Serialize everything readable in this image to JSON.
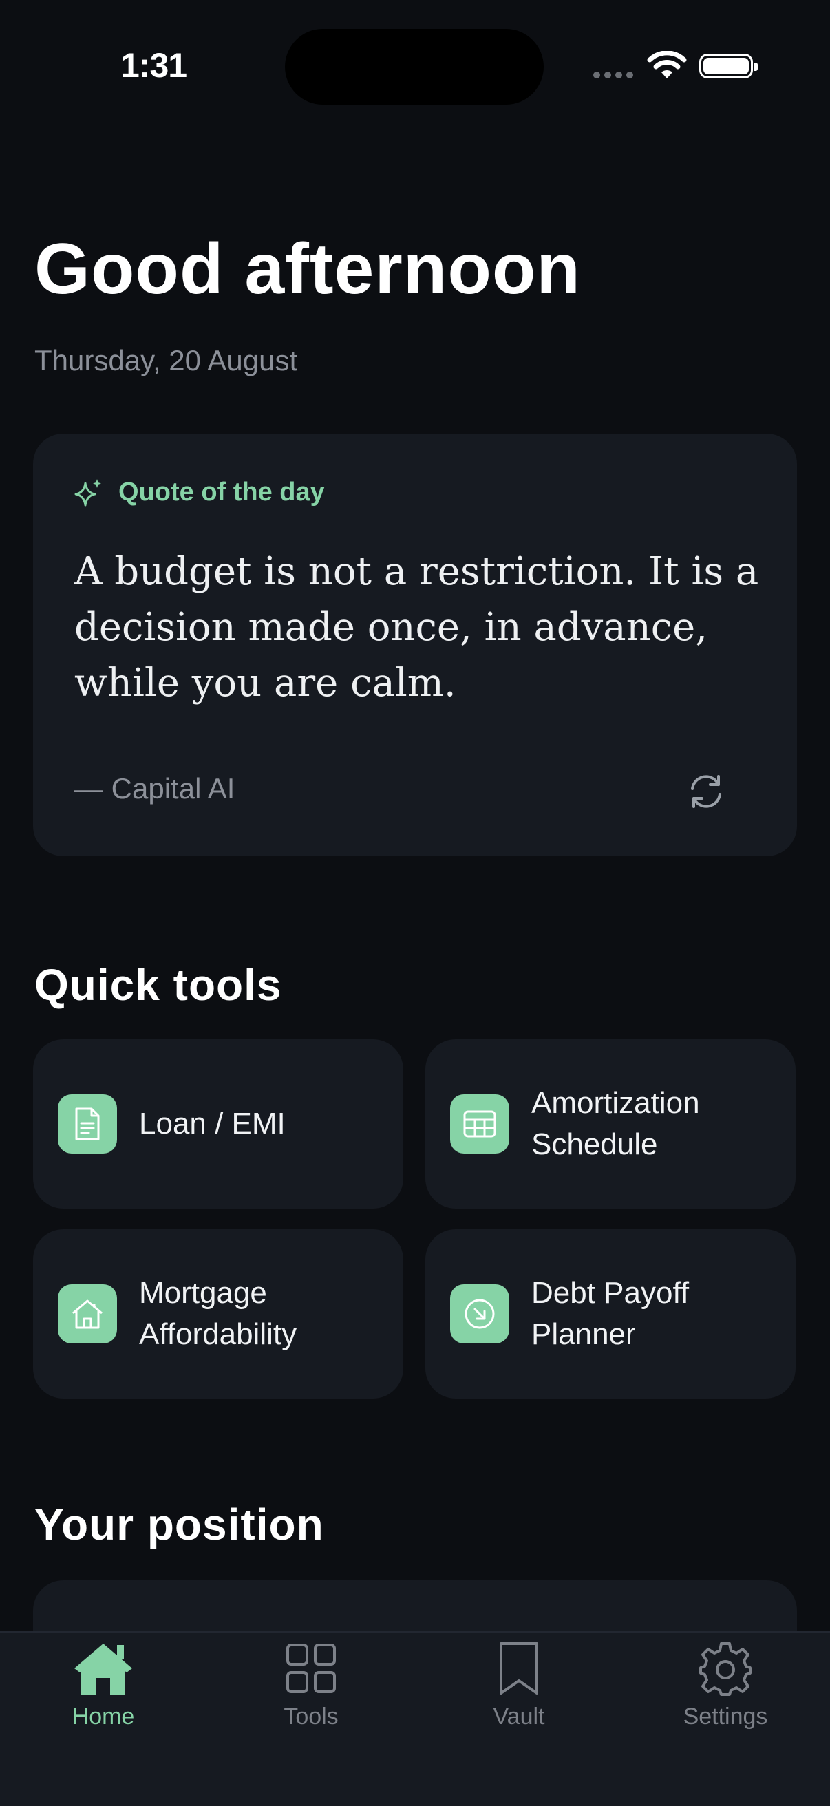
{
  "status_bar": {
    "time": "1:31"
  },
  "header": {
    "greeting": "Good afternoon",
    "date": "Thursday, 20 August"
  },
  "quote": {
    "label": "Quote of the day",
    "text": "A budget is not a restriction. It is a decision made once, in advance, while you are calm.",
    "author": "— Capital AI",
    "icons": {
      "label_icon": "sparkle-icon",
      "refresh_icon": "refresh-icon"
    }
  },
  "quick_tools": {
    "title": "Quick tools",
    "items": [
      {
        "label": "Loan / EMI",
        "icon": "document-icon"
      },
      {
        "label": "Amortization\nSchedule",
        "icon": "table-icon"
      },
      {
        "label": "Mortgage\nAffordability",
        "icon": "house-icon"
      },
      {
        "label": "Debt Payoff\nPlanner",
        "icon": "arrow-down-right-icon"
      }
    ]
  },
  "position": {
    "title": "Your position"
  },
  "tabbar": {
    "tabs": [
      {
        "label": "Home",
        "icon": "home-icon",
        "active": true
      },
      {
        "label": "Tools",
        "icon": "grid-icon",
        "active": false
      },
      {
        "label": "Vault",
        "icon": "bookmark-icon",
        "active": false
      },
      {
        "label": "Settings",
        "icon": "gear-icon",
        "active": false
      }
    ]
  },
  "colors": {
    "accent": "#86d3a6",
    "background": "#0c0e12",
    "card": "#161a21"
  }
}
